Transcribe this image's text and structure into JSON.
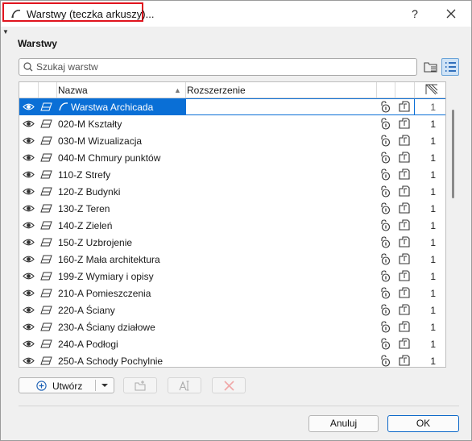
{
  "window": {
    "title": "Warstwy (teczka arkuszy)...",
    "help_label": "?",
    "close_icon": "close-icon"
  },
  "section": {
    "title": "Warstwy"
  },
  "search": {
    "placeholder": "Szukaj warstw",
    "value": ""
  },
  "table": {
    "headers": {
      "name": "Nazwa",
      "extension": "Rozszerzenie"
    },
    "rows": [
      {
        "name": "Warstwa Archicada",
        "value": "1",
        "selected": true
      },
      {
        "name": "020-M Kształty",
        "value": "1"
      },
      {
        "name": "030-M Wizualizacja",
        "value": "1"
      },
      {
        "name": "040-M Chmury punktów",
        "value": "1"
      },
      {
        "name": "110-Z Strefy",
        "value": "1"
      },
      {
        "name": "120-Z Budynki",
        "value": "1"
      },
      {
        "name": "130-Z Teren",
        "value": "1"
      },
      {
        "name": "140-Z Zieleń",
        "value": "1"
      },
      {
        "name": "150-Z Uzbrojenie",
        "value": "1"
      },
      {
        "name": "160-Z Mała architektura",
        "value": "1"
      },
      {
        "name": "199-Z Wymiary i opisy",
        "value": "1"
      },
      {
        "name": "210-A Pomieszczenia",
        "value": "1"
      },
      {
        "name": "220-A Ściany",
        "value": "1"
      },
      {
        "name": "230-A Ściany działowe",
        "value": "1"
      },
      {
        "name": "240-A Podłogi",
        "value": "1"
      },
      {
        "name": "250-A Schody Pochylnie",
        "value": "1"
      }
    ]
  },
  "toolbar": {
    "create_label": "Utwórz"
  },
  "footer": {
    "cancel_label": "Anuluj",
    "ok_label": "OK"
  },
  "colors": {
    "selection": "#0a6fd6",
    "close_x": "#e05050",
    "ok_border": "#0a66c8"
  }
}
